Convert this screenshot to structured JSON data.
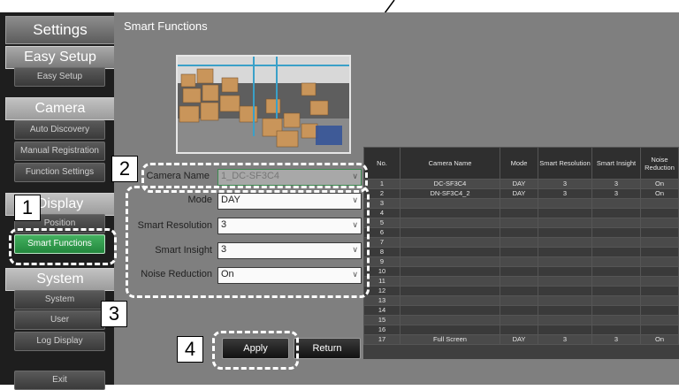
{
  "sidebar": {
    "title": "Settings",
    "sections": [
      {
        "header": "Easy Setup",
        "items": [
          "Easy Setup"
        ]
      },
      {
        "header": "Camera",
        "items": [
          "Auto Discovery",
          "Manual Registration",
          "Function Settings"
        ]
      },
      {
        "header": "Display",
        "items": [
          "Position",
          "Smart Functions"
        ]
      },
      {
        "header": "System",
        "items": [
          "System",
          "User",
          "Log Display"
        ]
      }
    ],
    "exit": "Exit"
  },
  "main": {
    "title": "Smart Functions",
    "fields": {
      "camera_name": {
        "label": "Camera Name",
        "value": "1_DC-SF3C4"
      },
      "mode": {
        "label": "Mode",
        "value": "DAY"
      },
      "smart_resolution": {
        "label": "Smart Resolution",
        "value": "3"
      },
      "smart_insight": {
        "label": "Smart Insight",
        "value": "3"
      },
      "noise_reduction": {
        "label": "Noise Reduction",
        "value": "On"
      }
    },
    "apply": "Apply",
    "return": "Return"
  },
  "callouts": [
    "1",
    "2",
    "3",
    "4"
  ],
  "table": {
    "headers": [
      "No.",
      "Camera Name",
      "Mode",
      "Smart Resolution",
      "Smart Insight",
      "Noise Reduction"
    ],
    "rows": [
      [
        "1",
        "DC-SF3C4",
        "DAY",
        "3",
        "3",
        "On"
      ],
      [
        "2",
        "DN-SF3C4_2",
        "DAY",
        "3",
        "3",
        "On"
      ],
      [
        "3",
        "",
        "",
        "",
        "",
        ""
      ],
      [
        "4",
        "",
        "",
        "",
        "",
        ""
      ],
      [
        "5",
        "",
        "",
        "",
        "",
        ""
      ],
      [
        "6",
        "",
        "",
        "",
        "",
        ""
      ],
      [
        "7",
        "",
        "",
        "",
        "",
        ""
      ],
      [
        "8",
        "",
        "",
        "",
        "",
        ""
      ],
      [
        "9",
        "",
        "",
        "",
        "",
        ""
      ],
      [
        "10",
        "",
        "",
        "",
        "",
        ""
      ],
      [
        "11",
        "",
        "",
        "",
        "",
        ""
      ],
      [
        "12",
        "",
        "",
        "",
        "",
        ""
      ],
      [
        "13",
        "",
        "",
        "",
        "",
        ""
      ],
      [
        "14",
        "",
        "",
        "",
        "",
        ""
      ],
      [
        "15",
        "",
        "",
        "",
        "",
        ""
      ],
      [
        "16",
        "",
        "",
        "",
        "",
        ""
      ],
      [
        "17",
        "Full Screen",
        "DAY",
        "3",
        "3",
        "On"
      ]
    ]
  },
  "colors": {
    "accent": "#2f9a4c",
    "callout_border": "#ffffff",
    "panel": "#7f7f7f"
  }
}
